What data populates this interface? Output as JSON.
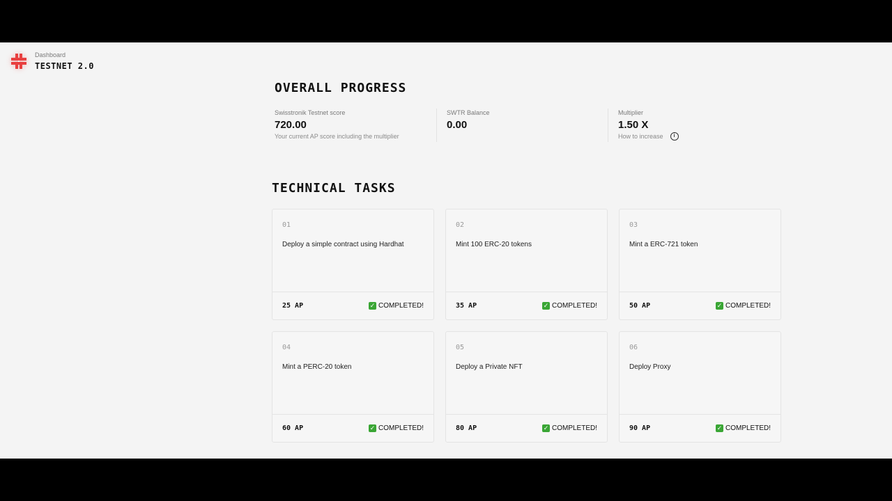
{
  "brand": {
    "breadcrumb": "Dashboard",
    "title": "TESTNET 2.0",
    "logo_icon": "swisstronik-logo-icon",
    "accent_color": "#e84040"
  },
  "overall_progress": {
    "heading": "OVERALL PROGRESS",
    "stats": [
      {
        "label": "Swisstronik Testnet score",
        "value": "720.00",
        "note": "Your current AP score including the multiplier"
      },
      {
        "label": "SWTR Balance",
        "value": "0.00",
        "note": ""
      },
      {
        "label": "Multiplier",
        "value": "1.50 X",
        "note": "How to increase",
        "icon": "info-icon"
      }
    ]
  },
  "technical_tasks": {
    "heading": "TECHNICAL TASKS",
    "tasks": [
      {
        "number": "01",
        "title": "Deploy a simple contract using Hardhat",
        "points": "25 AP",
        "status": "COMPLETED!"
      },
      {
        "number": "02",
        "title": "Mint 100 ERC-20 tokens",
        "points": "35 AP",
        "status": "COMPLETED!"
      },
      {
        "number": "03",
        "title": "Mint a ERC-721 token",
        "points": "50 AP",
        "status": "COMPLETED!"
      },
      {
        "number": "04",
        "title": "Mint a PERC-20 token",
        "points": "60 AP",
        "status": "COMPLETED!"
      },
      {
        "number": "05",
        "title": "Deploy a Private NFT",
        "points": "80 AP",
        "status": "COMPLETED!"
      },
      {
        "number": "06",
        "title": "Deploy Proxy",
        "points": "90 AP",
        "status": "COMPLETED!"
      }
    ],
    "status_icon": "check-icon",
    "status_color": "#3aa635"
  }
}
